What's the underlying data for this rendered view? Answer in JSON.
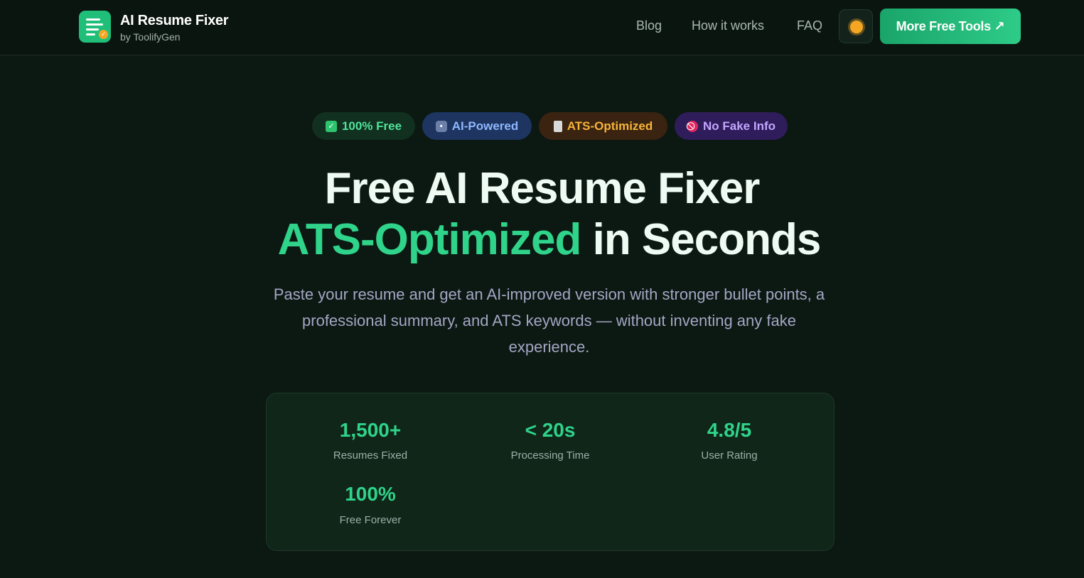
{
  "header": {
    "brand_title": "AI Resume Fixer",
    "brand_sub": "by ToolifyGen",
    "nav": [
      "Blog",
      "How it works",
      "FAQ"
    ],
    "theme_icon": "sun-icon",
    "cta_label": "More Free Tools ↗"
  },
  "badges": [
    {
      "label": "100% Free",
      "icon": "checkbox-icon"
    },
    {
      "label": "AI-Powered",
      "icon": "robot-icon"
    },
    {
      "label": "ATS-Optimized",
      "icon": "clipboard-icon"
    },
    {
      "label": "No Fake Info",
      "icon": "prohibited-icon"
    }
  ],
  "hero": {
    "line1": "Free AI Resume Fixer",
    "line2_accent": "ATS-Optimized",
    "line2_rest": " in Seconds",
    "description": "Paste your resume and get an AI-improved version with stronger bullet points, a professional summary, and ATS keywords — without inventing any fake experience."
  },
  "stats": [
    {
      "value": "1,500+",
      "label": "Resumes Fixed"
    },
    {
      "value": "< 20s",
      "label": "Processing Time"
    },
    {
      "value": "4.8/5",
      "label": "User Rating"
    },
    {
      "value": "100%",
      "label": "Free Forever"
    }
  ],
  "colors": {
    "background": "#0c1812",
    "accent": "#2fd38a",
    "cta": "#1fbf7a"
  }
}
